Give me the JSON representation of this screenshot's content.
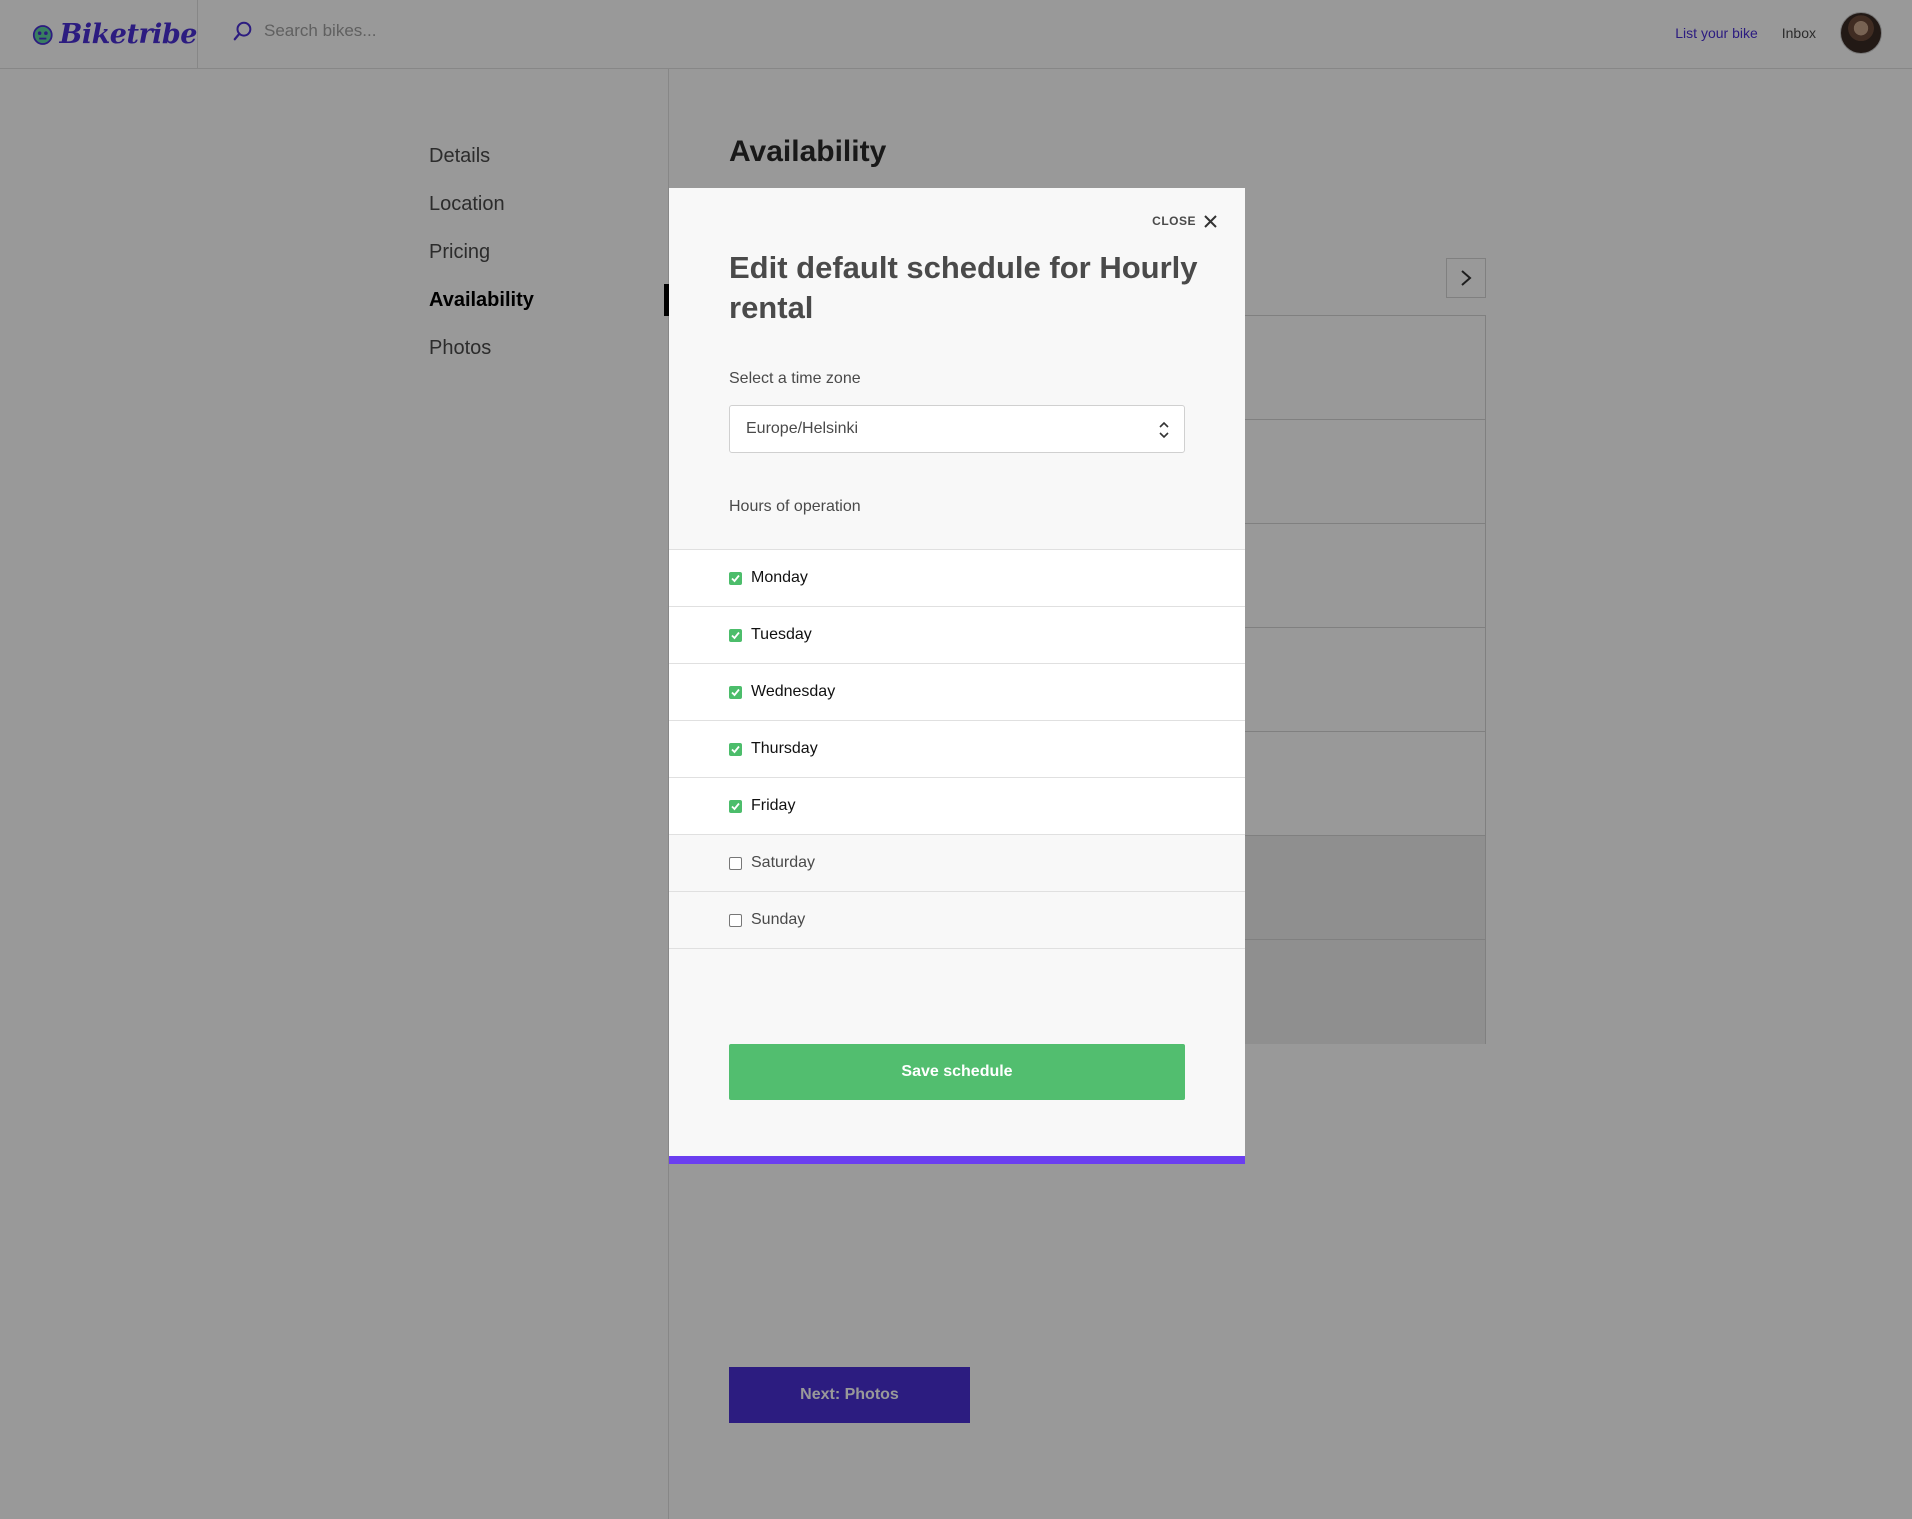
{
  "header": {
    "logo": "Biketribe",
    "search_placeholder": "Search bikes...",
    "list_bike": "List your bike",
    "inbox": "Inbox"
  },
  "sidebar": {
    "items": [
      {
        "label": "Details",
        "active": false
      },
      {
        "label": "Location",
        "active": false
      },
      {
        "label": "Pricing",
        "active": false
      },
      {
        "label": "Availability",
        "active": true
      },
      {
        "label": "Photos",
        "active": false
      }
    ]
  },
  "main": {
    "title": "Availability",
    "next_button": "Next: Photos"
  },
  "modal": {
    "close_label": "CLOSE",
    "title": "Edit default schedule for Hourly rental",
    "timezone_label": "Select a time zone",
    "timezone_value": "Europe/Helsinki",
    "hours_label": "Hours of operation",
    "days": [
      {
        "label": "Monday",
        "checked": true
      },
      {
        "label": "Tuesday",
        "checked": true
      },
      {
        "label": "Wednesday",
        "checked": true
      },
      {
        "label": "Thursday",
        "checked": true
      },
      {
        "label": "Friday",
        "checked": true
      },
      {
        "label": "Saturday",
        "checked": false
      },
      {
        "label": "Sunday",
        "checked": false
      }
    ],
    "save_button": "Save schedule"
  },
  "colors": {
    "brand": "#4a2fd6",
    "accent_green": "#52be6f",
    "modal_bar": "#6b3ef0"
  }
}
